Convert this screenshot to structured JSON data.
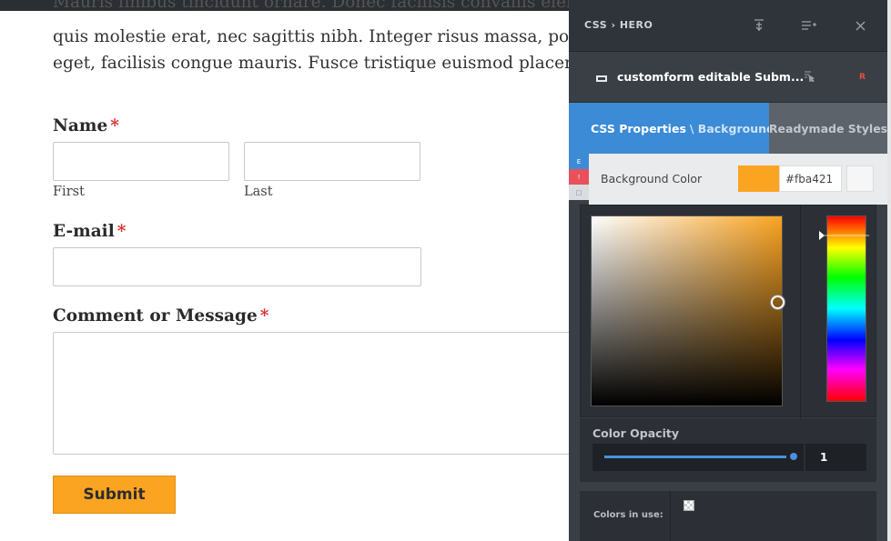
{
  "page": {
    "paragraph_lines": [
      "Mauris finibus tincidunt ornare. Donec facilisis convallis eleifend",
      "quis molestie erat, nec sagittis nibh. Integer risus massa, porttitor",
      "eget, facilisis congue mauris. Fusce tristique euismod placerat."
    ],
    "form": {
      "name_label": "Name",
      "required_mark": "*",
      "first_label": "First",
      "last_label": "Last",
      "email_label": "E-mail",
      "comment_label": "Comment or Message",
      "submit_label": "Submit"
    }
  },
  "panel": {
    "logo": "CSS › HERO",
    "header_icons": [
      "collapse-icon",
      "menu-add-icon",
      "close-icon"
    ],
    "selected_element": "customform editable Subm...",
    "selected_reset": "R",
    "tabs": {
      "css_properties": "CSS Properties",
      "css_sub": "\\ Background",
      "readymade": "Readymade Styles"
    },
    "side_strip": [
      "E",
      "!",
      "□"
    ],
    "background_color_label": "Background Color",
    "hex_value": "#fba421",
    "opacity_label": "Color Opacity",
    "opacity_value": "1",
    "colors_in_use_label": "Colors in use:"
  },
  "colors": {
    "accent_orange": "#fba421",
    "tab_blue": "#3b8bd6",
    "panel_dark": "#3a3f46",
    "required_red": "#d93030"
  }
}
